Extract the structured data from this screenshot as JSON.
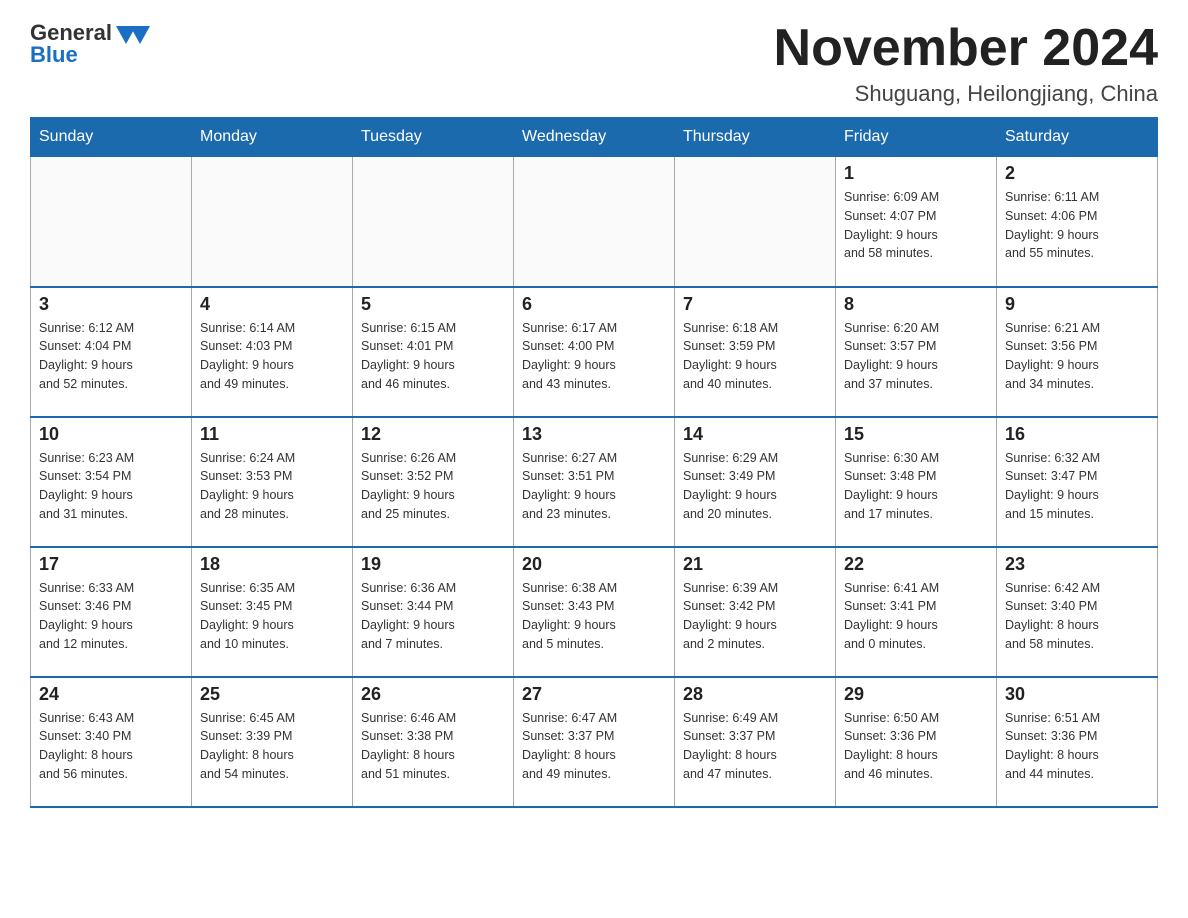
{
  "header": {
    "logo_text_general": "General",
    "logo_text_blue": "Blue",
    "title": "November 2024",
    "subtitle": "Shuguang, Heilongjiang, China"
  },
  "weekdays": [
    "Sunday",
    "Monday",
    "Tuesday",
    "Wednesday",
    "Thursday",
    "Friday",
    "Saturday"
  ],
  "weeks": [
    [
      {
        "day": "",
        "info": ""
      },
      {
        "day": "",
        "info": ""
      },
      {
        "day": "",
        "info": ""
      },
      {
        "day": "",
        "info": ""
      },
      {
        "day": "",
        "info": ""
      },
      {
        "day": "1",
        "info": "Sunrise: 6:09 AM\nSunset: 4:07 PM\nDaylight: 9 hours\nand 58 minutes."
      },
      {
        "day": "2",
        "info": "Sunrise: 6:11 AM\nSunset: 4:06 PM\nDaylight: 9 hours\nand 55 minutes."
      }
    ],
    [
      {
        "day": "3",
        "info": "Sunrise: 6:12 AM\nSunset: 4:04 PM\nDaylight: 9 hours\nand 52 minutes."
      },
      {
        "day": "4",
        "info": "Sunrise: 6:14 AM\nSunset: 4:03 PM\nDaylight: 9 hours\nand 49 minutes."
      },
      {
        "day": "5",
        "info": "Sunrise: 6:15 AM\nSunset: 4:01 PM\nDaylight: 9 hours\nand 46 minutes."
      },
      {
        "day": "6",
        "info": "Sunrise: 6:17 AM\nSunset: 4:00 PM\nDaylight: 9 hours\nand 43 minutes."
      },
      {
        "day": "7",
        "info": "Sunrise: 6:18 AM\nSunset: 3:59 PM\nDaylight: 9 hours\nand 40 minutes."
      },
      {
        "day": "8",
        "info": "Sunrise: 6:20 AM\nSunset: 3:57 PM\nDaylight: 9 hours\nand 37 minutes."
      },
      {
        "day": "9",
        "info": "Sunrise: 6:21 AM\nSunset: 3:56 PM\nDaylight: 9 hours\nand 34 minutes."
      }
    ],
    [
      {
        "day": "10",
        "info": "Sunrise: 6:23 AM\nSunset: 3:54 PM\nDaylight: 9 hours\nand 31 minutes."
      },
      {
        "day": "11",
        "info": "Sunrise: 6:24 AM\nSunset: 3:53 PM\nDaylight: 9 hours\nand 28 minutes."
      },
      {
        "day": "12",
        "info": "Sunrise: 6:26 AM\nSunset: 3:52 PM\nDaylight: 9 hours\nand 25 minutes."
      },
      {
        "day": "13",
        "info": "Sunrise: 6:27 AM\nSunset: 3:51 PM\nDaylight: 9 hours\nand 23 minutes."
      },
      {
        "day": "14",
        "info": "Sunrise: 6:29 AM\nSunset: 3:49 PM\nDaylight: 9 hours\nand 20 minutes."
      },
      {
        "day": "15",
        "info": "Sunrise: 6:30 AM\nSunset: 3:48 PM\nDaylight: 9 hours\nand 17 minutes."
      },
      {
        "day": "16",
        "info": "Sunrise: 6:32 AM\nSunset: 3:47 PM\nDaylight: 9 hours\nand 15 minutes."
      }
    ],
    [
      {
        "day": "17",
        "info": "Sunrise: 6:33 AM\nSunset: 3:46 PM\nDaylight: 9 hours\nand 12 minutes."
      },
      {
        "day": "18",
        "info": "Sunrise: 6:35 AM\nSunset: 3:45 PM\nDaylight: 9 hours\nand 10 minutes."
      },
      {
        "day": "19",
        "info": "Sunrise: 6:36 AM\nSunset: 3:44 PM\nDaylight: 9 hours\nand 7 minutes."
      },
      {
        "day": "20",
        "info": "Sunrise: 6:38 AM\nSunset: 3:43 PM\nDaylight: 9 hours\nand 5 minutes."
      },
      {
        "day": "21",
        "info": "Sunrise: 6:39 AM\nSunset: 3:42 PM\nDaylight: 9 hours\nand 2 minutes."
      },
      {
        "day": "22",
        "info": "Sunrise: 6:41 AM\nSunset: 3:41 PM\nDaylight: 9 hours\nand 0 minutes."
      },
      {
        "day": "23",
        "info": "Sunrise: 6:42 AM\nSunset: 3:40 PM\nDaylight: 8 hours\nand 58 minutes."
      }
    ],
    [
      {
        "day": "24",
        "info": "Sunrise: 6:43 AM\nSunset: 3:40 PM\nDaylight: 8 hours\nand 56 minutes."
      },
      {
        "day": "25",
        "info": "Sunrise: 6:45 AM\nSunset: 3:39 PM\nDaylight: 8 hours\nand 54 minutes."
      },
      {
        "day": "26",
        "info": "Sunrise: 6:46 AM\nSunset: 3:38 PM\nDaylight: 8 hours\nand 51 minutes."
      },
      {
        "day": "27",
        "info": "Sunrise: 6:47 AM\nSunset: 3:37 PM\nDaylight: 8 hours\nand 49 minutes."
      },
      {
        "day": "28",
        "info": "Sunrise: 6:49 AM\nSunset: 3:37 PM\nDaylight: 8 hours\nand 47 minutes."
      },
      {
        "day": "29",
        "info": "Sunrise: 6:50 AM\nSunset: 3:36 PM\nDaylight: 8 hours\nand 46 minutes."
      },
      {
        "day": "30",
        "info": "Sunrise: 6:51 AM\nSunset: 3:36 PM\nDaylight: 8 hours\nand 44 minutes."
      }
    ]
  ]
}
